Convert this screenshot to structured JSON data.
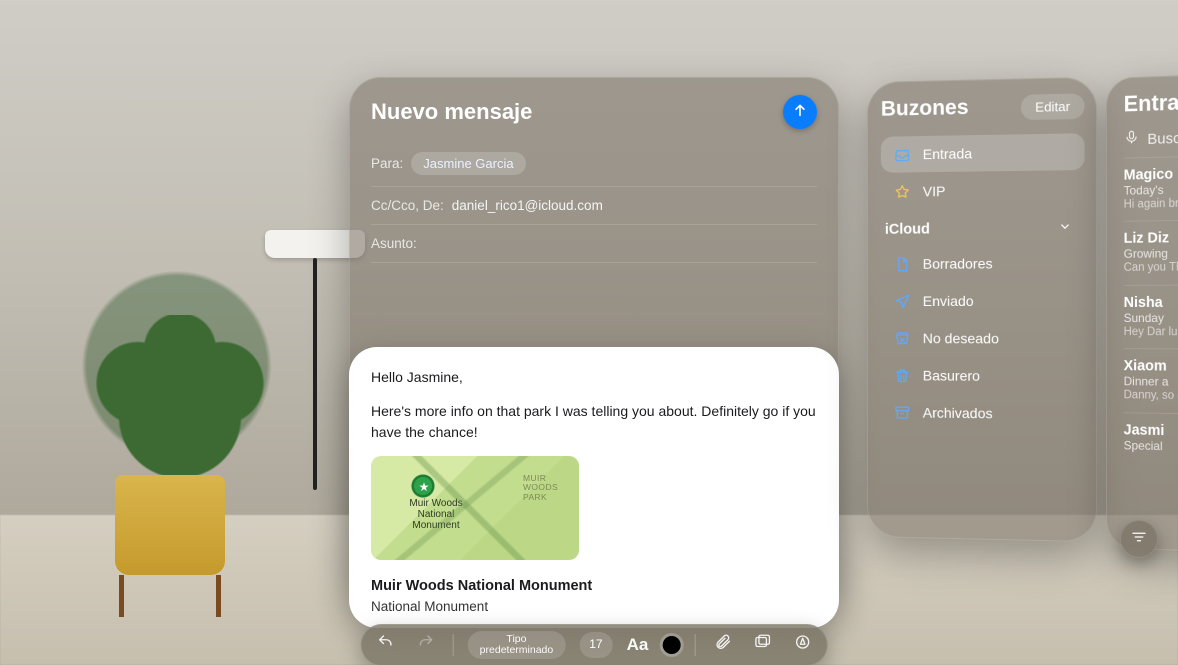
{
  "compose": {
    "title": "Nuevo mensaje",
    "to_label": "Para:",
    "to_recipient": "Jasmine Garcia",
    "cc_label": "Cc/Cco, De:",
    "cc_value": "daniel_rico1@icloud.com",
    "subject_label": "Asunto:",
    "body": {
      "greeting": "Hello Jasmine,",
      "para1": "Here's more info on that park I was telling you about. Definitely go if you have the chance!",
      "map_caption": "Muir Woods National Monument",
      "map_parklabel": "MUIR WOODS PARK",
      "attach_title": "Muir Woods National Monument",
      "attach_sub": "National Monument"
    }
  },
  "toolbar": {
    "font_family_line1": "Tipo",
    "font_family_line2": "predeterminado",
    "font_size": "17",
    "format_label": "Aa"
  },
  "mailboxes": {
    "title": "Buzones",
    "edit": "Editar",
    "top": [
      {
        "icon": "inbox",
        "label": "Entrada",
        "selected": true
      },
      {
        "icon": "star",
        "label": "VIP",
        "selected": false
      }
    ],
    "section": "iCloud",
    "items": [
      {
        "icon": "doc",
        "label": "Borradores"
      },
      {
        "icon": "send",
        "label": "Enviado"
      },
      {
        "icon": "junk",
        "label": "No deseado"
      },
      {
        "icon": "trash",
        "label": "Basurero"
      },
      {
        "icon": "archive",
        "label": "Archivados"
      }
    ]
  },
  "inbox": {
    "title": "Entra",
    "search_placeholder": "Busc",
    "messages": [
      {
        "sender": "Magico",
        "subject": "Today's",
        "preview": "Hi again\nbreathta"
      },
      {
        "sender": "Liz Diz",
        "subject": "Growing",
        "preview": "Can you\nThanks"
      },
      {
        "sender": "Nisha",
        "subject": "Sunday",
        "preview": "Hey Dar\nlunch or"
      },
      {
        "sender": "Xiaom",
        "subject": "Dinner a",
        "preview": "Danny,\nso much"
      },
      {
        "sender": "Jasmi",
        "subject": "Special",
        "preview": ""
      }
    ]
  }
}
